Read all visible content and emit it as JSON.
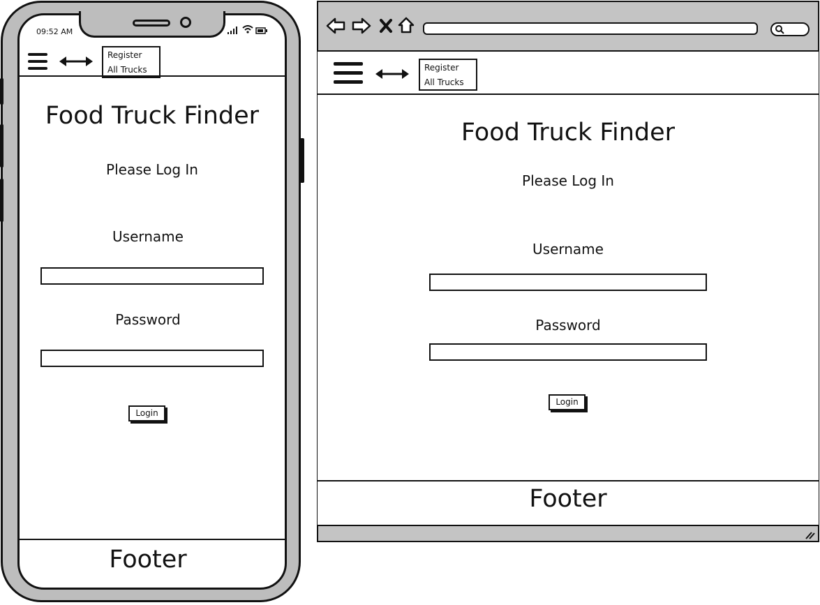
{
  "mobile": {
    "status_time": "09:52 AM",
    "nav": {
      "menu_icon": "hamburger-icon",
      "resize_icon": "double-arrow-icon",
      "links": [
        "Register",
        "All Trucks"
      ]
    },
    "title": "Food Truck Finder",
    "subtitle": "Please Log In",
    "username_label": "Username",
    "password_label": "Password",
    "login_button": "Login",
    "footer": "Footer"
  },
  "desktop": {
    "toolbar_icons": [
      "back-icon",
      "forward-icon",
      "stop-icon",
      "home-icon",
      "search-icon"
    ],
    "nav": {
      "menu_icon": "hamburger-icon",
      "resize_icon": "double-arrow-icon",
      "links": [
        "Register",
        "All Trucks"
      ]
    },
    "title": "Food Truck Finder",
    "subtitle": "Please Log In",
    "username_label": "Username",
    "password_label": "Password",
    "login_button": "Login",
    "footer": "Footer"
  }
}
